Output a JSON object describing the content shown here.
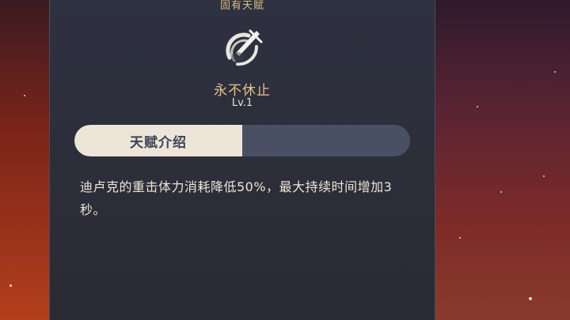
{
  "talent": {
    "category": "固有天赋",
    "name": "永不休止",
    "level": "Lv.1",
    "icon": "sword-shield-icon"
  },
  "tabs": [
    {
      "label": "天赋介绍",
      "active": true
    },
    {
      "label": "",
      "active": false
    }
  ],
  "description": "迪卢克的重击体力消耗降低50%，最大持续时间增加3秒。",
  "colors": {
    "accent_gold": "#e3c58d",
    "panel_bg": "#2c2e3a",
    "tab_active_bg": "#ece5d8",
    "tab_inactive_bg": "#4a5064",
    "text_light": "#ece5d8"
  }
}
